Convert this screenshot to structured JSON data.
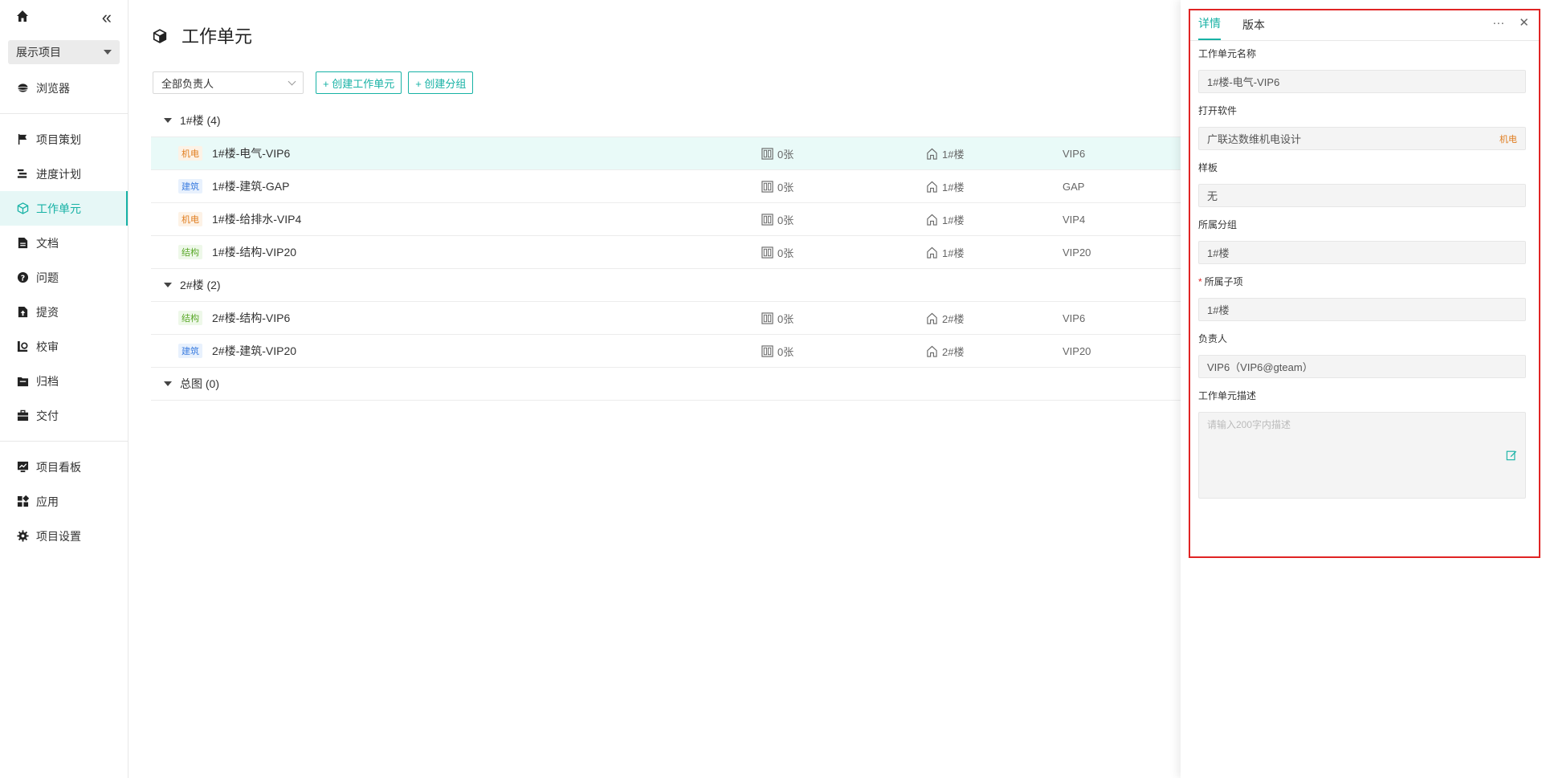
{
  "sidebar": {
    "project": "展示项目",
    "items": [
      {
        "label": "浏览器",
        "icon": "browser-icon"
      },
      {
        "label": "项目策划",
        "icon": "flag-icon"
      },
      {
        "label": "进度计划",
        "icon": "schedule-icon"
      },
      {
        "label": "工作单元",
        "icon": "cube-icon"
      },
      {
        "label": "文档",
        "icon": "document-icon"
      },
      {
        "label": "问题",
        "icon": "question-icon"
      },
      {
        "label": "提资",
        "icon": "submit-icon"
      },
      {
        "label": "校审",
        "icon": "review-icon"
      },
      {
        "label": "归档",
        "icon": "archive-icon"
      },
      {
        "label": "交付",
        "icon": "briefcase-icon"
      },
      {
        "label": "项目看板",
        "icon": "dashboard-icon"
      },
      {
        "label": "应用",
        "icon": "apps-icon"
      },
      {
        "label": "项目设置",
        "icon": "gear-icon"
      }
    ]
  },
  "main": {
    "title": "工作单元",
    "owner_filter": "全部负责人",
    "create_unit": "+ 创建工作单元",
    "create_group": "+ 创建分组",
    "groups": [
      {
        "name": "1#楼",
        "count": "(4)"
      },
      {
        "name": "2#楼",
        "count": "(2)"
      },
      {
        "name": "总图",
        "count": "(0)"
      }
    ],
    "rows": [
      {
        "tag": "机电",
        "name": "1#楼-电气-VIP6",
        "sheets": "0张",
        "floor": "1#楼",
        "owner": "VIP6"
      },
      {
        "tag": "建筑",
        "name": "1#楼-建筑-GAP",
        "sheets": "0张",
        "floor": "1#楼",
        "owner": "GAP"
      },
      {
        "tag": "机电",
        "name": "1#楼-给排水-VIP4",
        "sheets": "0张",
        "floor": "1#楼",
        "owner": "VIP4"
      },
      {
        "tag": "结构",
        "name": "1#楼-结构-VIP20",
        "sheets": "0张",
        "floor": "1#楼",
        "owner": "VIP20"
      },
      {
        "tag": "结构",
        "name": "2#楼-结构-VIP6",
        "sheets": "0张",
        "floor": "2#楼",
        "owner": "VIP6"
      },
      {
        "tag": "建筑",
        "name": "2#楼-建筑-VIP20",
        "sheets": "0张",
        "floor": "2#楼",
        "owner": "VIP20"
      }
    ]
  },
  "panel": {
    "tab_detail": "详情",
    "tab_version": "版本",
    "more": "···",
    "close": "✕",
    "fields": {
      "name_label": "工作单元名称",
      "name_value": "1#楼-电气-VIP6",
      "software_label": "打开软件",
      "software_value": "广联达数维机电设计",
      "software_tag": "机电",
      "template_label": "样板",
      "template_value": "无",
      "group_label": "所属分组",
      "group_value": "1#楼",
      "sub_label": "所属子项",
      "sub_value": "1#楼",
      "owner_label": "负责人",
      "owner_value": "VIP6（VIP6@gteam）",
      "desc_label": "工作单元描述",
      "desc_placeholder": "请输入200字内描述"
    }
  }
}
